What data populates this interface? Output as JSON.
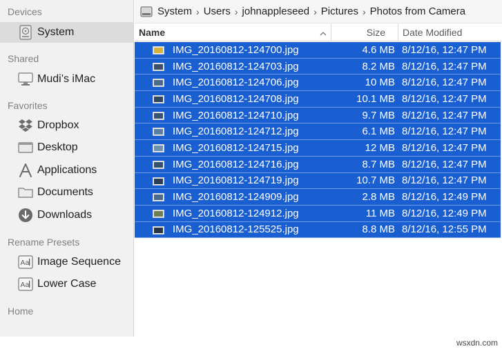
{
  "sidebar": {
    "groups": {
      "devices": "Devices",
      "shared": "Shared",
      "favorites": "Favorites",
      "rename_presets": "Rename Presets",
      "home": "Home"
    },
    "items": {
      "system": "System",
      "mudis_imac": "Mudi’s iMac",
      "dropbox": "Dropbox",
      "desktop": "Desktop",
      "applications": "Applications",
      "documents": "Documents",
      "downloads": "Downloads",
      "image_sequence": "Image Sequence",
      "lower_case": "Lower Case"
    },
    "selected": "System"
  },
  "pathbar": {
    "crumbs": [
      "System",
      "Users",
      "johnappleseed",
      "Pictures",
      "Photos from Camera"
    ],
    "separator": "›"
  },
  "columns": {
    "name": "Name",
    "size": "Size",
    "date": "Date Modified"
  },
  "files": [
    {
      "name": "IMG_20160812-124700.jpg",
      "size": "4.6 MB",
      "date": "8/12/16, 12:47 PM",
      "thumb_color": "#d8b23a"
    },
    {
      "name": "IMG_20160812-124703.jpg",
      "size": "8.2 MB",
      "date": "8/12/16, 12:47 PM",
      "thumb_color": "#3d4f6b"
    },
    {
      "name": "IMG_20160812-124706.jpg",
      "size": "10 MB",
      "date": "8/12/16, 12:47 PM",
      "thumb_color": "#4a6a8a"
    },
    {
      "name": "IMG_20160812-124708.jpg",
      "size": "10.1 MB",
      "date": "8/12/16, 12:47 PM",
      "thumb_color": "#2f4660"
    },
    {
      "name": "IMG_20160812-124710.jpg",
      "size": "9.7 MB",
      "date": "8/12/16, 12:47 PM",
      "thumb_color": "#3a5272"
    },
    {
      "name": "IMG_20160812-124712.jpg",
      "size": "6.1 MB",
      "date": "8/12/16, 12:47 PM",
      "thumb_color": "#5a7fa6"
    },
    {
      "name": "IMG_20160812-124715.jpg",
      "size": "12 MB",
      "date": "8/12/16, 12:47 PM",
      "thumb_color": "#6f8fb3"
    },
    {
      "name": "IMG_20160812-124716.jpg",
      "size": "8.7 MB",
      "date": "8/12/16, 12:47 PM",
      "thumb_color": "#34516f"
    },
    {
      "name": "IMG_20160812-124719.jpg",
      "size": "10.7 MB",
      "date": "8/12/16, 12:47 PM",
      "thumb_color": "#2d3f58"
    },
    {
      "name": "IMG_20160812-124909.jpg",
      "size": "2.8 MB",
      "date": "8/12/16, 12:49 PM",
      "thumb_color": "#4d6a8c"
    },
    {
      "name": "IMG_20160812-124912.jpg",
      "size": "11 MB",
      "date": "8/12/16, 12:49 PM",
      "thumb_color": "#6d7f54"
    },
    {
      "name": "IMG_20160812-125525.jpg",
      "size": "8.8 MB",
      "date": "8/12/16, 12:55 PM",
      "thumb_color": "#2a3548"
    }
  ],
  "watermark": "wsxdn.com",
  "colors": {
    "selection": "#1a5fd1",
    "sidebar_bg": "#f1f1f1",
    "sidebar_active": "#dcdcdc"
  }
}
